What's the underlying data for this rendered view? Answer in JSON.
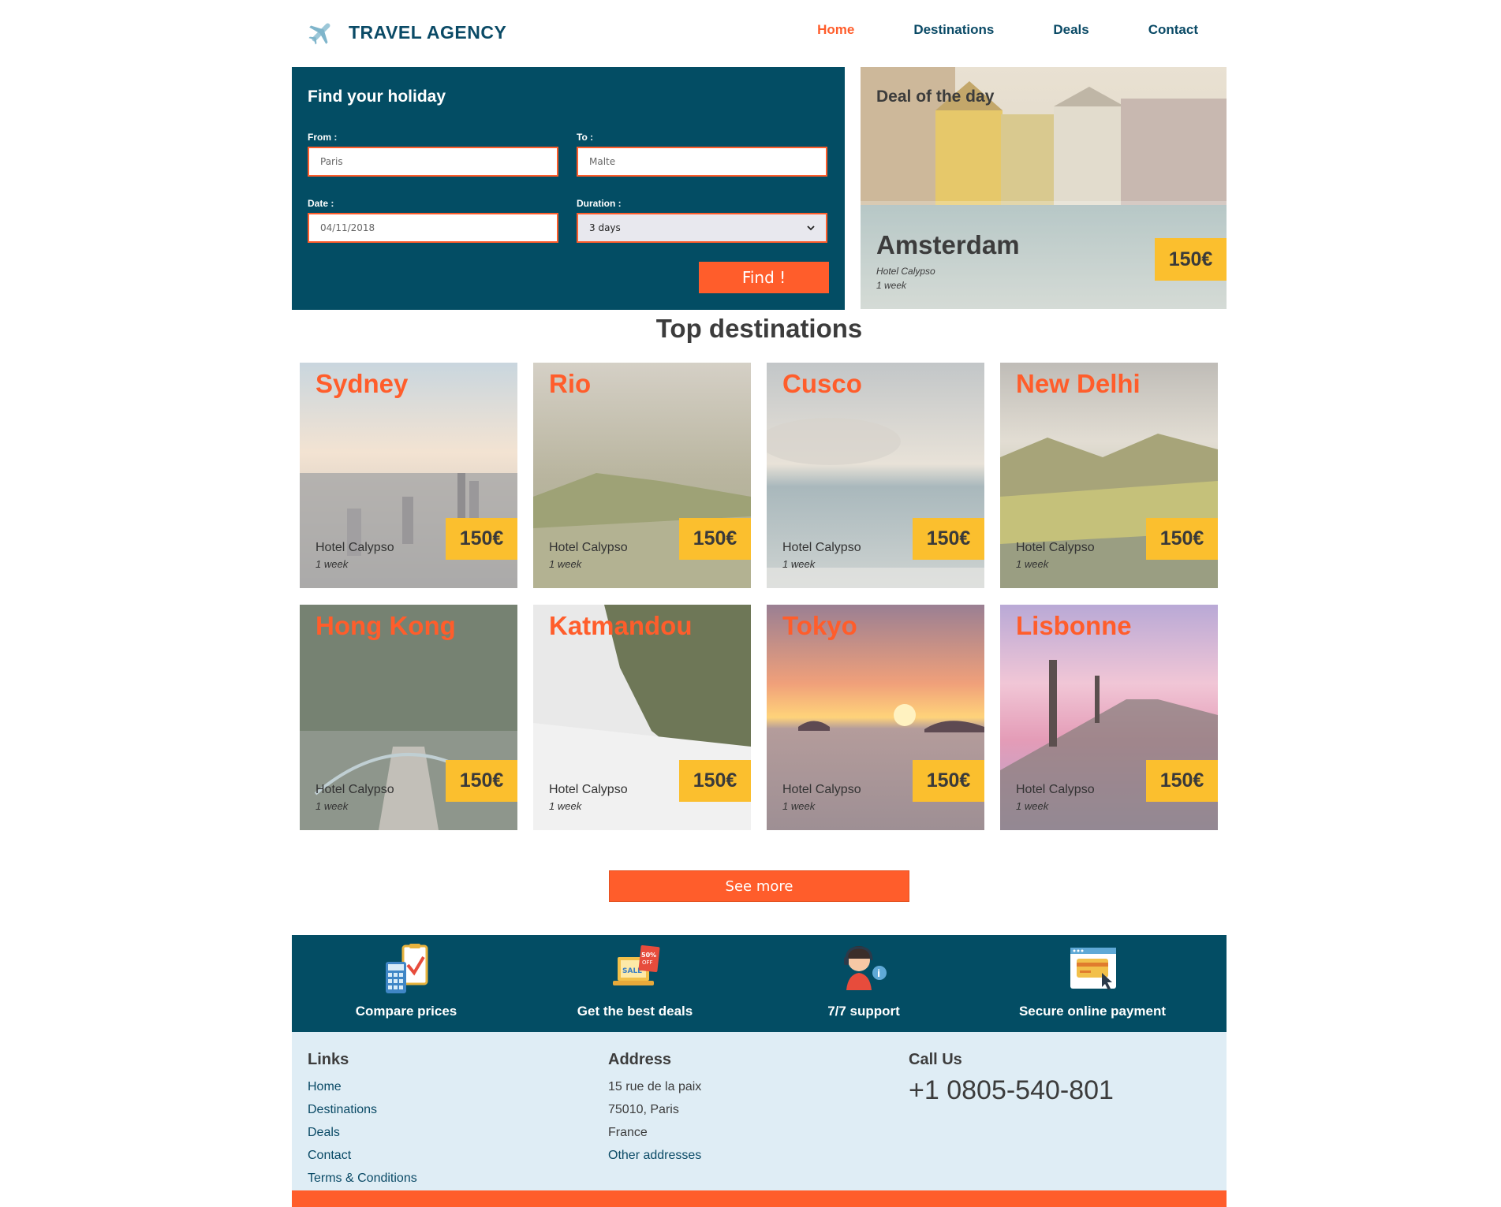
{
  "header": {
    "logo_text": "TRAVEL AGENCY",
    "nav": [
      "Home",
      "Destinations",
      "Deals",
      "Contact"
    ],
    "active_nav": "Home"
  },
  "search": {
    "title": "Find your holiday",
    "from_label": "From :",
    "from_value": "Paris",
    "to_label": "To :",
    "to_value": "Malte",
    "date_label": "Date :",
    "date_value": "04/11/2018",
    "duration_label": "Duration :",
    "duration_value": "3 days",
    "find_label": "Find !"
  },
  "deal": {
    "title": "Deal of the day",
    "city": "Amsterdam",
    "hotel": "Hotel Calypso",
    "duration": "1 week",
    "price": "150€"
  },
  "top_destinations": {
    "title": "Top destinations",
    "cards": [
      {
        "city": "Sydney",
        "hotel": "Hotel Calypso",
        "duration": "1 week",
        "price": "150€"
      },
      {
        "city": "Rio",
        "hotel": "Hotel Calypso",
        "duration": "1 week",
        "price": "150€"
      },
      {
        "city": "Cusco",
        "hotel": "Hotel Calypso",
        "duration": "1 week",
        "price": "150€"
      },
      {
        "city": "New Delhi",
        "hotel": "Hotel Calypso",
        "duration": "1 week",
        "price": "150€"
      },
      {
        "city": "Hong Kong",
        "hotel": "Hotel Calypso",
        "duration": "1 week",
        "price": "150€"
      },
      {
        "city": "Katmandou",
        "hotel": "Hotel Calypso",
        "duration": "1 week",
        "price": "150€"
      },
      {
        "city": "Tokyo",
        "hotel": "Hotel Calypso",
        "duration": "1 week",
        "price": "150€"
      },
      {
        "city": "Lisbonne",
        "hotel": "Hotel Calypso",
        "duration": "1 week",
        "price": "150€"
      }
    ],
    "see_more_label": "See more"
  },
  "features": [
    {
      "label": "Compare prices",
      "icon": "calculator-checklist-icon"
    },
    {
      "label": "Get the best deals",
      "icon": "laptop-sale-icon"
    },
    {
      "label": "7/7 support",
      "icon": "support-agent-icon"
    },
    {
      "label": "Secure online payment",
      "icon": "credit-card-window-icon"
    }
  ],
  "footer": {
    "links_title": "Links",
    "links": [
      "Home",
      "Destinations",
      "Deals",
      "Contact",
      "Terms & Conditions"
    ],
    "address_title": "Address",
    "address_lines": [
      "15 rue de la paix",
      "75010, Paris",
      "France"
    ],
    "other_addresses": "Other addresses",
    "call_title": "Call Us",
    "phone": "+1 0805-540-801"
  },
  "colors": {
    "primary": "#034d64",
    "accent": "#ff5d2b",
    "price": "#fbbf2e",
    "footer_bg": "#dfedf5"
  }
}
